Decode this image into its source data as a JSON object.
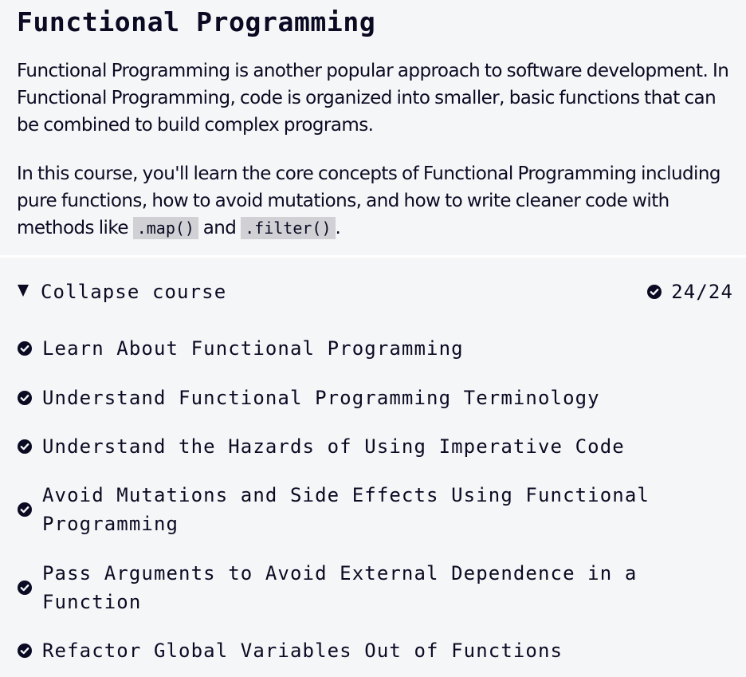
{
  "intro": {
    "title": "Functional Programming",
    "para1": "Functional Programming is another popular approach to software development. In Functional Programming, code is organized into smaller, basic functions that can be combined to build complex programs.",
    "para2_before": "In this course, you'll learn the core concepts of Functional Programming including pure functions, how to avoid mutations, and how to write cleaner code with methods like ",
    "code_map": ".map()",
    "para2_and": " and ",
    "code_filter": ".filter()",
    "para2_end": "."
  },
  "course": {
    "collapse_label": "Collapse course",
    "progress": "24/24",
    "lessons": [
      {
        "label": "Learn About Functional Programming",
        "completed": true
      },
      {
        "label": "Understand Functional Programming Terminology",
        "completed": true
      },
      {
        "label": "Understand the Hazards of Using Imperative Code",
        "completed": true
      },
      {
        "label": "Avoid Mutations and Side Effects Using Functional Programming",
        "completed": true
      },
      {
        "label": "Pass Arguments to Avoid External Dependence in a Function",
        "completed": true
      },
      {
        "label": "Refactor Global Variables Out of Functions",
        "completed": true
      }
    ]
  },
  "icons": {
    "collapse": "triangle-down-icon",
    "check": "check-circle-icon"
  },
  "colors": {
    "background": "#f5f6f7",
    "text": "#0a0a23",
    "code_background": "#d0d0d5",
    "divider": "#ffffff"
  }
}
